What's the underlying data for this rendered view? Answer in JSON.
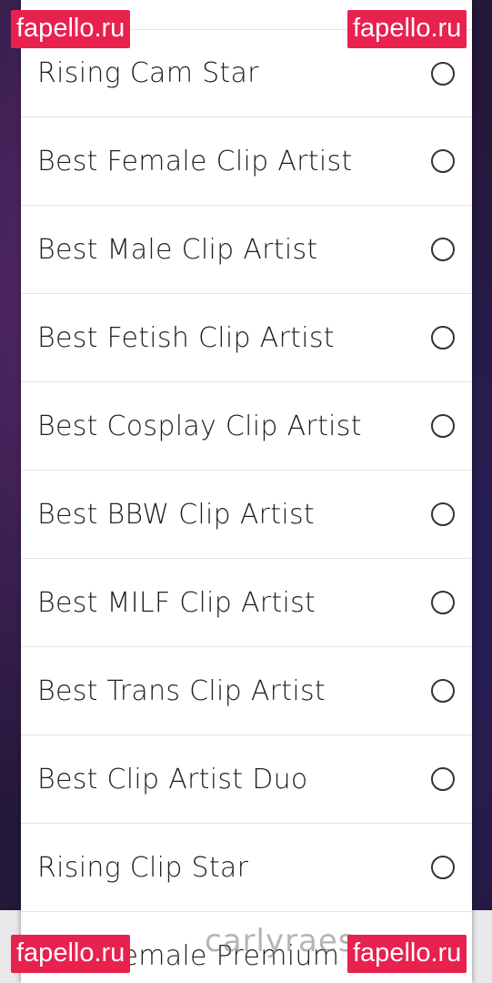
{
  "options": [
    {
      "label": "Rising Cam Star",
      "selected": false
    },
    {
      "label": "Best Female Clip Artist",
      "selected": false
    },
    {
      "label": "Best Male Clip Artist",
      "selected": false
    },
    {
      "label": "Best Fetish Clip Artist",
      "selected": false
    },
    {
      "label": "Best Cosplay Clip Artist",
      "selected": false
    },
    {
      "label": "Best BBW Clip Artist",
      "selected": false
    },
    {
      "label": "Best MILF Clip Artist",
      "selected": false
    },
    {
      "label": "Best Trans Clip Artist",
      "selected": false
    },
    {
      "label": "Best Clip Artist Duo",
      "selected": false
    },
    {
      "label": "Rising Clip Star",
      "selected": false
    },
    {
      "label": "Best Female Premium Snap",
      "selected": false
    }
  ],
  "watermark": {
    "text": "fapello.ru",
    "color": "#e8214f"
  },
  "overlay_text": "carlyraes"
}
